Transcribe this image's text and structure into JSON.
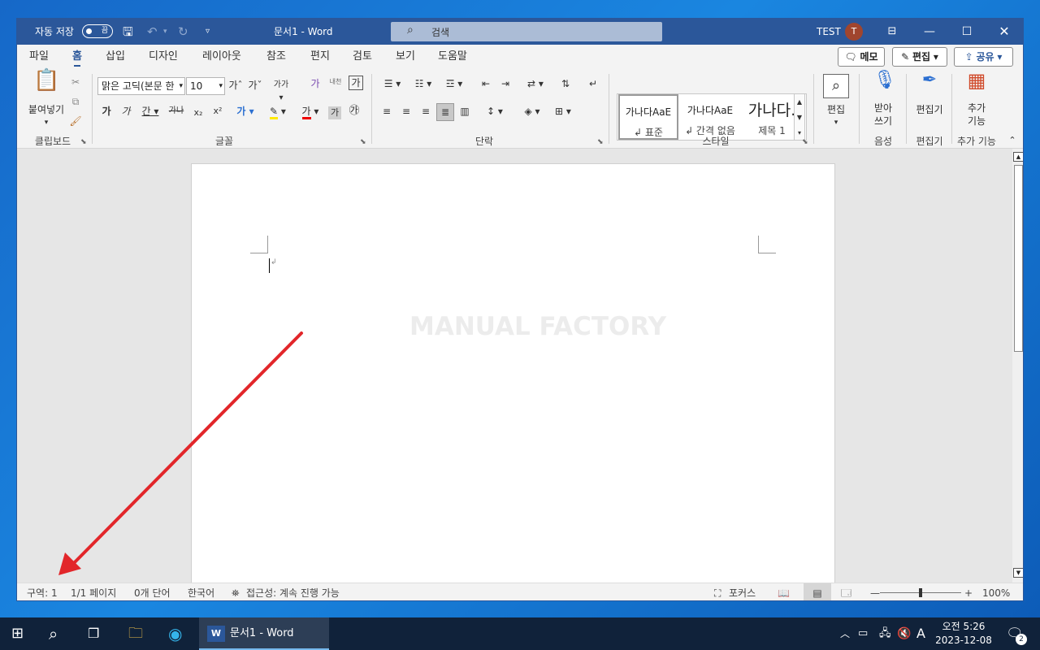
{
  "titlebar": {
    "autosave_label": "자동 저장",
    "autosave_state": "끔",
    "doc_title": "문서1  -  Word",
    "search_placeholder": "검색",
    "user_name": "TEST",
    "user_initial": "T"
  },
  "tabs": [
    "파일",
    "홈",
    "삽입",
    "디자인",
    "레이아웃",
    "참조",
    "편지",
    "검토",
    "보기",
    "도움말"
  ],
  "active_tab": "홈",
  "tab_buttons": {
    "memo": "메모",
    "edit": "편집",
    "share": "공유"
  },
  "ribbon": {
    "clipboard": {
      "paste": "붙여넣기",
      "label": "클립보드"
    },
    "font": {
      "name": "맑은 고딕(본문 한",
      "size": "10",
      "label": "글꼴"
    },
    "paragraph": {
      "label": "단락"
    },
    "styles": {
      "label": "스타일",
      "items": [
        {
          "preview": "가나다AaE",
          "name": "↲ 표준"
        },
        {
          "preview": "가나다AaE",
          "name": "↲ 간격 없음"
        },
        {
          "preview": "가나다.",
          "name": "제목 1"
        }
      ]
    },
    "editing": {
      "button": "편집"
    },
    "dictate": {
      "button": "받아\n쓰기",
      "label": "음성"
    },
    "editor": {
      "button": "편집기",
      "label": "편집기"
    },
    "addins": {
      "button": "추가\n기능",
      "label": "추가 기능"
    }
  },
  "document": {
    "watermark": "MANUAL FACTORY"
  },
  "status": {
    "section": "구역: 1",
    "pages": "1/1 페이지",
    "words": "0개 단어",
    "language": "한국어",
    "accessibility": "접근성: 계속 진행 가능",
    "focus": "포커스",
    "zoom": "100%",
    "zoom_level": 100
  },
  "taskbar": {
    "active_app": "문서1 - Word",
    "ime": "A",
    "time": "오전 5:26",
    "date": "2023-12-08",
    "notifications": "2"
  },
  "colors": {
    "word_blue": "#2b579a",
    "annotation_arrow": "#e2262a",
    "taskbar": "#10223a"
  }
}
